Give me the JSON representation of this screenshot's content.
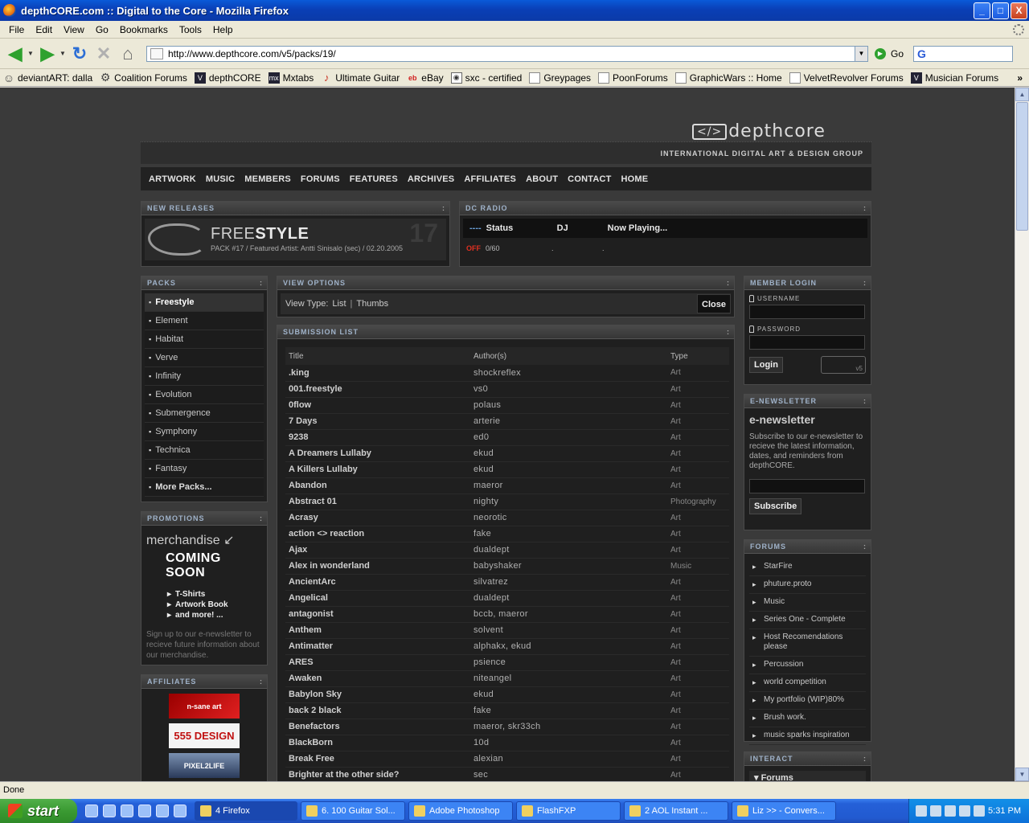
{
  "window": {
    "title": "depthCORE.com :: Digital to the Core - Mozilla Firefox",
    "min": "_",
    "max": "□",
    "close": "X"
  },
  "menu": [
    "File",
    "Edit",
    "View",
    "Go",
    "Bookmarks",
    "Tools",
    "Help"
  ],
  "nav": {
    "back": "◀",
    "fwd": "▶",
    "reload": "↻",
    "stop": "✕",
    "home": "⌂",
    "url": "http://www.depthcore.com/v5/packs/19/",
    "go": "Go",
    "search_logo": "G"
  },
  "bookmarks": [
    {
      "label": "deviantART: dalla",
      "icon": "deviantart-icon"
    },
    {
      "label": "Coalition Forums",
      "icon": "gear-icon"
    },
    {
      "label": "depthCORE",
      "icon": "depthcore-icon"
    },
    {
      "label": "Mxtabs",
      "icon": "mxtabs-icon"
    },
    {
      "label": "Ultimate Guitar",
      "icon": "guitar-icon"
    },
    {
      "label": "eBay",
      "icon": "ebay-icon"
    },
    {
      "label": "sxc - certified",
      "icon": "camera-icon"
    },
    {
      "label": "Greypages",
      "icon": "page-icon"
    },
    {
      "label": "PoonForums",
      "icon": "page-icon"
    },
    {
      "label": "GraphicWars :: Home",
      "icon": "page-icon"
    },
    {
      "label": "VelvetRevolver Forums",
      "icon": "page-icon"
    },
    {
      "label": "Musician Forums",
      "icon": "depthcore-icon"
    }
  ],
  "site": {
    "logo": "depthcore",
    "tagline": "INTERNATIONAL DIGITAL ART & DESIGN GROUP",
    "mainnav": [
      "ARTWORK",
      "MUSIC",
      "MEMBERS",
      "FORUMS",
      "FEATURES",
      "ARCHIVES",
      "AFFILIATES",
      "ABOUT",
      "CONTACT",
      "HOME"
    ],
    "new_releases": {
      "header": "NEW RELEASES",
      "title_a": "FREE",
      "title_b": "STYLE",
      "sub": "PACK #17   /   Featured Artist: Antti Sinisalo (sec)   /   02.20.2005",
      "num": "17"
    },
    "radio": {
      "header": "DC RADIO",
      "dots": "----",
      "status": "Status",
      "dj": "DJ",
      "now": "Now Playing...",
      "off": "OFF",
      "count": "0/60",
      "dj_val": ".",
      "now_val": "."
    },
    "packs": {
      "header": "PACKS",
      "items": [
        "Freestyle",
        "Element",
        "Habitat",
        "Verve",
        "Infinity",
        "Evolution",
        "Submergence",
        "Symphony",
        "Technica",
        "Fantasy",
        "More Packs..."
      ]
    },
    "promotions": {
      "header": "PROMOTIONS",
      "merch": "merchandise",
      "soon": "COMING SOON",
      "items": [
        "T-Shirts",
        "Artwork Book",
        "and more! ..."
      ],
      "note": "Sign up to our e-newsletter to recieve future information about our merchandise."
    },
    "affiliates": {
      "header": "AFFILIATES",
      "items": [
        "n-sane art",
        "555 DESIGN",
        "PIXEL2LIFE"
      ]
    },
    "view_options": {
      "header": "VIEW OPTIONS",
      "label": "View Type:",
      "list": "List",
      "sep": "|",
      "thumbs": "Thumbs",
      "close": "Close"
    },
    "submissions": {
      "header": "SUBMISSION LIST",
      "columns": [
        "Title",
        "Author(s)",
        "Type"
      ],
      "rows": [
        [
          ".king",
          "shockreflex",
          "Art"
        ],
        [
          "001.freestyle",
          "vs0",
          "Art"
        ],
        [
          "0flow",
          "polaus",
          "Art"
        ],
        [
          "7 Days",
          "arterie",
          "Art"
        ],
        [
          "9238",
          "ed0",
          "Art"
        ],
        [
          "A Dreamers Lullaby",
          "ekud",
          "Art"
        ],
        [
          "A Killers Lullaby",
          "ekud",
          "Art"
        ],
        [
          "Abandon",
          "maeror",
          "Art"
        ],
        [
          "Abstract 01",
          "nighty",
          "Photography"
        ],
        [
          "Acrasy",
          "neorotic",
          "Art"
        ],
        [
          "action <> reaction",
          "fake",
          "Art"
        ],
        [
          "Ajax",
          "dualdept",
          "Art"
        ],
        [
          "Alex in wonderland",
          "babyshaker",
          "Music"
        ],
        [
          "AncientArc",
          "silvatrez",
          "Art"
        ],
        [
          "Angelical",
          "dualdept",
          "Art"
        ],
        [
          "antagonist",
          "bccb, maeror",
          "Art"
        ],
        [
          "Anthem",
          "solvent",
          "Art"
        ],
        [
          "Antimatter",
          "alphakx, ekud",
          "Art"
        ],
        [
          "ARES",
          "psience",
          "Art"
        ],
        [
          "Awaken",
          "niteangel",
          "Art"
        ],
        [
          "Babylon Sky",
          "ekud",
          "Art"
        ],
        [
          "back 2 black",
          "fake",
          "Art"
        ],
        [
          "Benefactors",
          "maeror, skr33ch",
          "Art"
        ],
        [
          "BlackBorn",
          "10d",
          "Art"
        ],
        [
          "Break Free",
          "alexian",
          "Art"
        ],
        [
          "Brighter at the other side?",
          "sec",
          "Art"
        ]
      ]
    },
    "login": {
      "header": "MEMBER LOGIN",
      "username": "USERNAME",
      "password": "PASSWORD",
      "button": "Login",
      "badge": "v5"
    },
    "newsletter": {
      "header": "E-NEWSLETTER",
      "title": "e-newsletter",
      "text": "Subscribe to our e-newsletter to recieve the latest information, dates, and reminders from depthCORE.",
      "button": "Subscribe"
    },
    "forums": {
      "header": "FORUMS",
      "items": [
        "StarFire",
        "phuture.proto",
        "Music",
        "Series One - Complete",
        "Host Recomendations please",
        "Percussion",
        "world competition",
        "My portfolio (WIP)80%",
        "Brush work.",
        "music sparks inspiration"
      ]
    },
    "interact": {
      "header": "INTERACT",
      "first": "Forums"
    }
  },
  "status": "Done",
  "taskbar": {
    "start": "start",
    "tasks": [
      "4 Firefox",
      "6. 100 Guitar Sol...",
      "Adobe Photoshop",
      "FlashFXP",
      "2 AOL Instant ...",
      "Liz >> - Convers..."
    ],
    "clock": "5:31 PM"
  }
}
